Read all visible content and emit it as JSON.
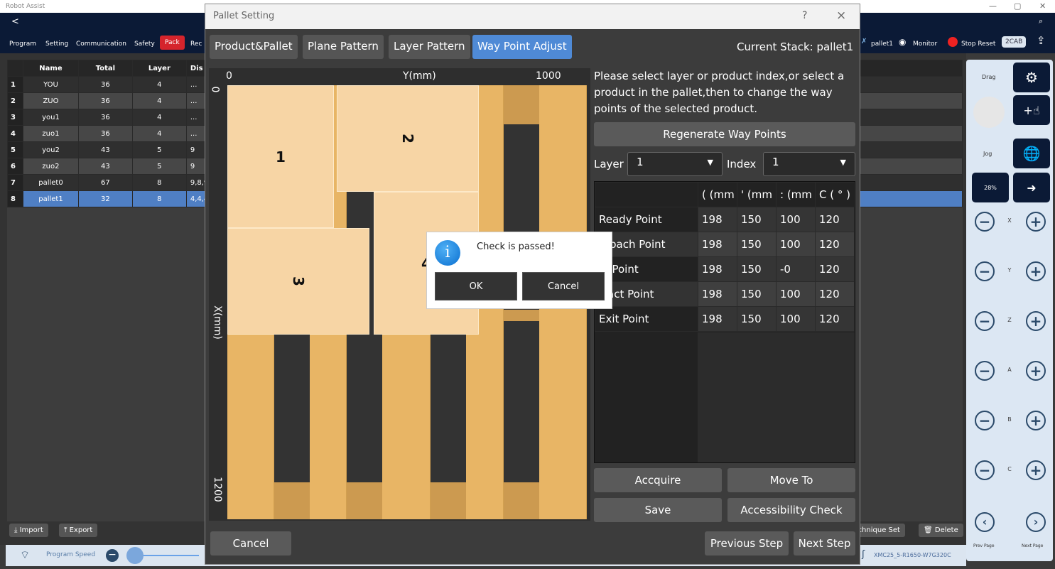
{
  "app": {
    "title": "Robot Assist"
  },
  "header": {
    "back": "<",
    "nav": [
      "Program",
      "Setting",
      "Communication",
      "Safety",
      "Pack",
      "Rec"
    ],
    "active_nav": "Pack",
    "right": {
      "stack": "pallet1",
      "monitor": "Monitor",
      "stop_reset": "Stop Reset",
      "badge": "2CAB"
    }
  },
  "stack_table": {
    "columns": [
      "Name",
      "Total",
      "Layer",
      "Dis"
    ],
    "rows": [
      {
        "i": "1",
        "name": "YOU",
        "total": "36",
        "layer": "4",
        "dis": "..."
      },
      {
        "i": "2",
        "name": "ZUO",
        "total": "36",
        "layer": "4",
        "dis": "..."
      },
      {
        "i": "3",
        "name": "you1",
        "total": "36",
        "layer": "4",
        "dis": "..."
      },
      {
        "i": "4",
        "name": "zuo1",
        "total": "36",
        "layer": "4",
        "dis": "..."
      },
      {
        "i": "5",
        "name": "you2",
        "total": "43",
        "layer": "5",
        "dis": "9"
      },
      {
        "i": "6",
        "name": "zuo2",
        "total": "43",
        "layer": "5",
        "dis": "9"
      },
      {
        "i": "7",
        "name": "pallet0",
        "total": "67",
        "layer": "8",
        "dis": "9,8,9"
      },
      {
        "i": "8",
        "name": "pallet1",
        "total": "32",
        "layer": "8",
        "dis": "4,4,4"
      }
    ],
    "selected": "8"
  },
  "bottom": {
    "import": "Import",
    "export": "Export",
    "technique": "Technique Set",
    "delete": "Delete"
  },
  "status": {
    "program_speed": "Program Speed",
    "controller": "XMC25_5-R1650-W7G320C",
    "speed_value": 5
  },
  "right_panel": {
    "drag": "Drag",
    "jog": "Jog",
    "speed": "28%",
    "axes": [
      "X",
      "Y",
      "Z",
      "A",
      "B",
      "C"
    ],
    "prev": "Prev Page",
    "next": "Next Page"
  },
  "dialog": {
    "title": "Pallet Setting",
    "help": "?",
    "close": "×",
    "tabs": [
      "Product&Pallet",
      "Plane Pattern",
      "Layer Pattern",
      "Way Point Adjust"
    ],
    "active_tab": "Way Point Adjust",
    "current_stack": "Current Stack: pallet1",
    "canvas": {
      "y_label": "Y(mm)",
      "x_label": "X(mm)",
      "y0": "0",
      "y1": "1000",
      "x0": "0",
      "x1": "1200",
      "products": [
        "1",
        "2",
        "3",
        "4"
      ],
      "pallet_color": "#e8b565",
      "product_color": "#f7d5a5"
    },
    "instructions": "Please select layer or product index,or select a product in the pallet,then to change the way points of the selected product.",
    "regenerate": "Regenerate Way Points",
    "layer_label": "Layer",
    "layer_value": "1",
    "index_label": "Index",
    "index_value": "1",
    "wp_columns": [
      "( (mm",
      "' (mm",
      ": (mm",
      "C ( ° )"
    ],
    "wp_rows": [
      {
        "name": "Ready Point",
        "v": [
          "198",
          "150",
          "100",
          "120"
        ]
      },
      {
        "name": "proach Point",
        "v": [
          "198",
          "150",
          "100",
          "120"
        ]
      },
      {
        "name": "bj Point",
        "v": [
          "198",
          "150",
          "-0",
          "120"
        ]
      },
      {
        "name": "tract Point",
        "v": [
          "198",
          "150",
          "100",
          "120"
        ]
      },
      {
        "name": "Exit Point",
        "v": [
          "198",
          "150",
          "100",
          "120"
        ]
      }
    ],
    "acquire": "Accquire",
    "move_to": "Move To",
    "save": "Save",
    "accessibility": "Accessibility Check",
    "cancel": "Cancel",
    "prev": "Previous Step",
    "next": "Next Step"
  },
  "message": {
    "text": "Check is passed!",
    "ok": "OK",
    "cancel": "Cancel"
  }
}
